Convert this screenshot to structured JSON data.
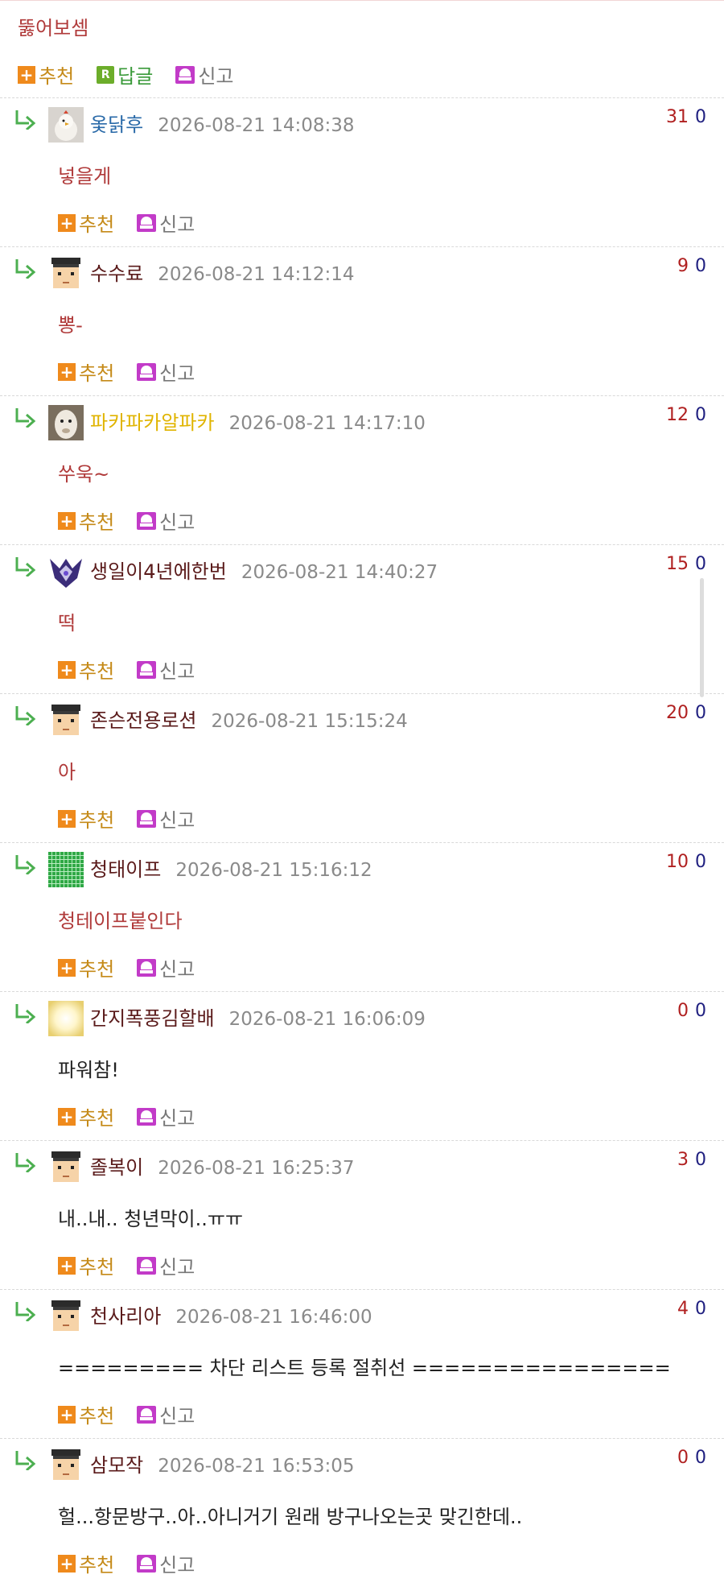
{
  "top": {
    "text": "뚫어보셈",
    "recommend": "추천",
    "reply": "답글",
    "report": "신고"
  },
  "comments": [
    {
      "nick": "옻닭후",
      "date": "2026-08-21 14:08:38",
      "up": "31",
      "down": "0",
      "text": "넣을게",
      "avatar": "chicken-avatar"
    },
    {
      "nick": "수수료",
      "date": "2026-08-21 14:12:14",
      "up": "9",
      "down": "0",
      "text": "뽕-",
      "avatar": "pixel-default-avatar"
    },
    {
      "nick": "파카파카알파카",
      "date": "2026-08-21 14:17:10",
      "up": "12",
      "down": "0",
      "text": "쑤욱~",
      "avatar": "alpaca-avatar"
    },
    {
      "nick": "생일이4년에한번",
      "date": "2026-08-21 14:40:27",
      "up": "15",
      "down": "0",
      "text": "떡",
      "avatar": "armor-avatar"
    },
    {
      "nick": "존슨전용로션",
      "date": "2026-08-21 15:15:24",
      "up": "20",
      "down": "0",
      "text": "아",
      "avatar": "pixel-default-avatar"
    },
    {
      "nick": "청태이프",
      "date": "2026-08-21 15:16:12",
      "up": "10",
      "down": "0",
      "text": "청테이프붙인다",
      "avatar": "green-grid-avatar"
    },
    {
      "nick": "간지폭풍김할배",
      "date": "2026-08-21 16:06:09",
      "up": "0",
      "down": "0",
      "text": "파워참!",
      "avatar": "light-avatar"
    },
    {
      "nick": "졸복이",
      "date": "2026-08-21 16:25:37",
      "up": "3",
      "down": "0",
      "text": "내..내.. 청년막이..ㅠㅠ",
      "avatar": "pixel-default-avatar"
    },
    {
      "nick": "천사리아",
      "date": "2026-08-21 16:46:00",
      "up": "4",
      "down": "0",
      "text": "========= 차단 리스트 등록 절취선 ================",
      "avatar": "pixel-default-avatar"
    },
    {
      "nick": "삼모작",
      "date": "2026-08-21 16:53:05",
      "up": "0",
      "down": "0",
      "text": "헐...항문방구..아..아니거기 원래 방구나오는곳 맞긴한데..",
      "avatar": "pixel-default-avatar"
    }
  ],
  "labels": {
    "recommend": "추천",
    "report": "신고"
  },
  "colors": {
    "accent": "#ef8a1c",
    "report": "#c23bc8",
    "reply_green": "#6cad2a",
    "text_red": "#b03a3a"
  }
}
